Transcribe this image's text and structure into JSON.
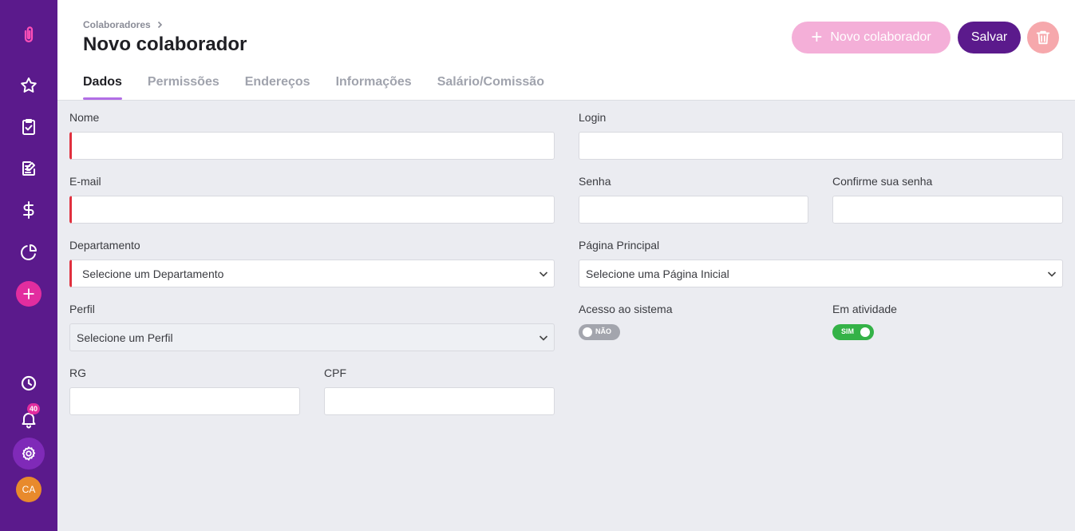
{
  "sidebar": {
    "icons": [
      "paperclip-logo-icon",
      "star-icon",
      "clipboard-check-icon",
      "edit-document-icon",
      "dollar-icon",
      "pie-chart-icon",
      "plus-icon",
      "clock-icon",
      "bell-icon",
      "gear-icon"
    ],
    "notification_count": "40",
    "avatar_initials": "CA"
  },
  "header": {
    "breadcrumb": "Colaboradores",
    "title": "Novo colaborador",
    "new_button_label": "Novo colaborador",
    "save_button_label": "Salvar"
  },
  "tabs": [
    {
      "label": "Dados",
      "active": true
    },
    {
      "label": "Permissões",
      "active": false
    },
    {
      "label": "Endereços",
      "active": false
    },
    {
      "label": "Informações",
      "active": false
    },
    {
      "label": "Salário/Comissão",
      "active": false
    }
  ],
  "form": {
    "nome": {
      "label": "Nome",
      "value": ""
    },
    "login": {
      "label": "Login",
      "value": ""
    },
    "email": {
      "label": "E-mail",
      "value": ""
    },
    "senha": {
      "label": "Senha",
      "value": ""
    },
    "confirme_senha": {
      "label": "Confirme sua senha",
      "value": ""
    },
    "departamento": {
      "label": "Departamento",
      "value": "Selecione um Departamento"
    },
    "pagina_principal": {
      "label": "Página Principal",
      "value": "Selecione uma Página Inicial"
    },
    "perfil": {
      "label": "Perfil",
      "value": "Selecione um Perfil"
    },
    "acesso_sistema": {
      "label": "Acesso ao sistema",
      "state": "NÃO"
    },
    "em_atividade": {
      "label": "Em atividade",
      "state": "SIM"
    },
    "rg": {
      "label": "RG",
      "value": ""
    },
    "cpf": {
      "label": "CPF",
      "value": ""
    }
  },
  "colors": {
    "sidebar": "#5b1a8c",
    "accent_pink": "#e22d9f",
    "required": "#e0303e",
    "toggle_on": "#34b247",
    "toggle_off": "#a3a5ad"
  }
}
